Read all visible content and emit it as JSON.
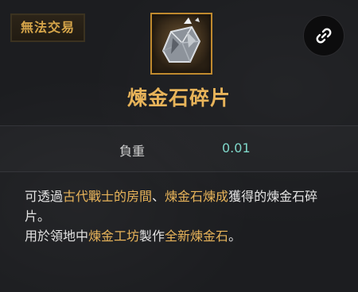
{
  "badge": {
    "label": "無法交易"
  },
  "item": {
    "name": "煉金石碎片",
    "icon": "alchemy-stone-shard-icon"
  },
  "actions": {
    "link_icon": "link-icon"
  },
  "stats": [
    {
      "label": "負重",
      "value": "0.01"
    }
  ],
  "description": {
    "line1": {
      "pre": "可透過",
      "hl1": "古代戰士的房間",
      "mid": "、",
      "hl2": "煉金石煉成",
      "post": "獲得的煉金石碎片。"
    },
    "line2": {
      "pre": "用於領地中",
      "hl1": "煉金工坊",
      "mid": "製作",
      "hl2": "全新煉金石",
      "post": "。"
    }
  },
  "colors": {
    "accent_gold": "#e8b45a",
    "value_teal": "#7fd7c9",
    "panel_bg": "#1c1d20"
  }
}
